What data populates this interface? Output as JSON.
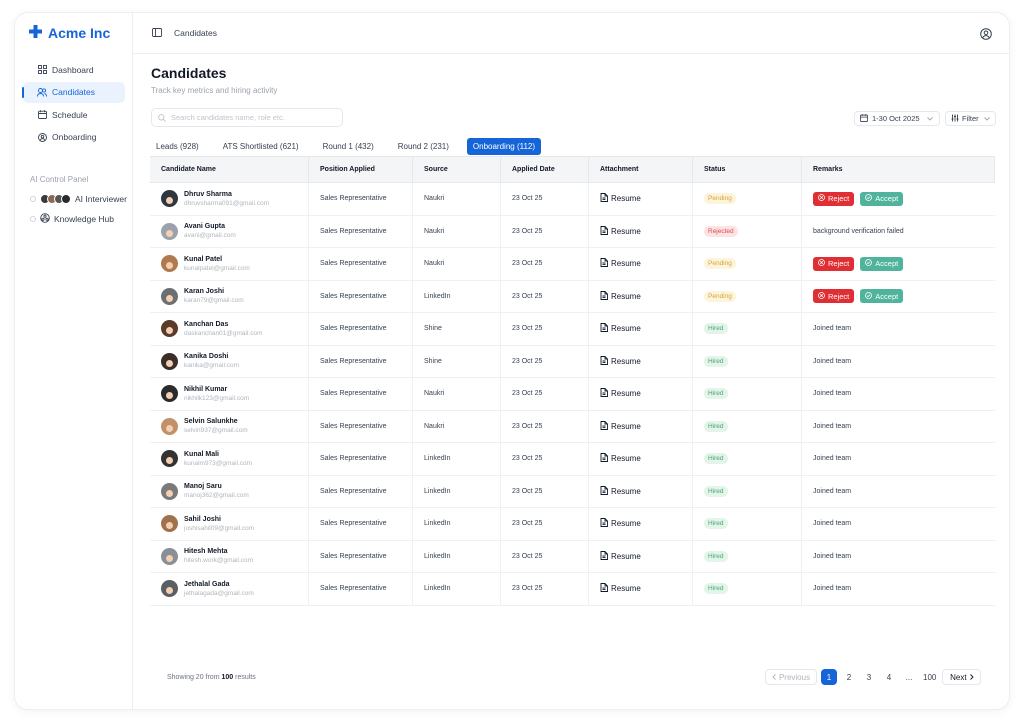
{
  "brand": {
    "name": "Acme Inc",
    "color": "#1565d8"
  },
  "sidebar": {
    "items": [
      {
        "label": "Dashboard",
        "icon": "grid-icon",
        "active": false
      },
      {
        "label": "Candidates",
        "icon": "users-icon",
        "active": true
      },
      {
        "label": "Schedule",
        "icon": "calendar-icon",
        "active": false
      },
      {
        "label": "Onboarding",
        "icon": "onboarding-icon",
        "active": false
      }
    ],
    "ai_panel": {
      "title": "AI Control Panel",
      "items": [
        {
          "label": "AI Interviewer",
          "icon": "avatars-group-icon"
        },
        {
          "label": "Knowledge Hub",
          "icon": "knowledge-hub-icon"
        }
      ]
    }
  },
  "topbar": {
    "breadcrumb": "Candidates",
    "sidebar_toggle_icon": "sidebar-toggle-icon",
    "user_icon": "user-circle-icon"
  },
  "page": {
    "title": "Candidates",
    "subtitle": "Track key metrics and hiring activity",
    "search_placeholder": "Search candidates name, role etc.",
    "date_range": "1-30 Oct 2025",
    "filter_label": "Filter"
  },
  "tabs": [
    {
      "label": "Leads (928)",
      "active": false
    },
    {
      "label": "ATS Shortlisted (621)",
      "active": false
    },
    {
      "label": "Round 1 (432)",
      "active": false
    },
    {
      "label": "Round 2 (231)",
      "active": false
    },
    {
      "label": "Onboarding (112)",
      "active": true
    }
  ],
  "table": {
    "columns": [
      "Candidate Name",
      "Position Applied",
      "Source",
      "Applied Date",
      "Attachment",
      "Status",
      "Remarks"
    ],
    "reject_label": "Reject",
    "accept_label": "Accept",
    "rows": [
      {
        "name": "Dhruv Sharma",
        "email": "dhruvsharma091@gmail.com",
        "position": "Sales Representative",
        "source": "Naukri",
        "date": "23 Oct 25",
        "attachment": "Resume",
        "status": "Pending",
        "remarks": "",
        "actions": true,
        "avatar_color": "#2f3640"
      },
      {
        "name": "Avani Gupta",
        "email": "avani@gmail.com",
        "position": "Sales Representative",
        "source": "Naukri",
        "date": "23 Oct 25",
        "attachment": "Resume",
        "status": "Rejected",
        "remarks": "background verification failed",
        "actions": false,
        "avatar_color": "#9aa3ad"
      },
      {
        "name": "Kunal Patel",
        "email": "kunalpatel@gmail.com",
        "position": "Sales Representative",
        "source": "Naukri",
        "date": "23 Oct 25",
        "attachment": "Resume",
        "status": "Pending",
        "remarks": "",
        "actions": true,
        "avatar_color": "#b07a4f"
      },
      {
        "name": "Karan Joshi",
        "email": "karan79@gmail.com",
        "position": "Sales Representative",
        "source": "LinkedIn",
        "date": "23 Oct 25",
        "attachment": "Resume",
        "status": "Pending",
        "remarks": "",
        "actions": true,
        "avatar_color": "#6d6f73"
      },
      {
        "name": "Kanchan Das",
        "email": "daskanchan01@gmail.com",
        "position": "Sales Representative",
        "source": "Shine",
        "date": "23 Oct 25",
        "attachment": "Resume",
        "status": "Hired",
        "remarks": "Joined team",
        "actions": false,
        "avatar_color": "#5a3a2a"
      },
      {
        "name": "Kanika Doshi",
        "email": "kanika@gmail.com",
        "position": "Sales Representative",
        "source": "Shine",
        "date": "23 Oct 25",
        "attachment": "Resume",
        "status": "Hired",
        "remarks": "Joined team",
        "actions": false,
        "avatar_color": "#3a2e2a"
      },
      {
        "name": "Nikhil Kumar",
        "email": "nikhilk123@gmail.com",
        "position": "Sales Representative",
        "source": "Naukri",
        "date": "23 Oct 25",
        "attachment": "Resume",
        "status": "Hired",
        "remarks": "Joined team",
        "actions": false,
        "avatar_color": "#2b2b2b"
      },
      {
        "name": "Selvin Salunkhe",
        "email": "selvin937@gmail.com",
        "position": "Sales Representative",
        "source": "Naukri",
        "date": "23 Oct 25",
        "attachment": "Resume",
        "status": "Hired",
        "remarks": "Joined team",
        "actions": false,
        "avatar_color": "#c2916a"
      },
      {
        "name": "Kunal Mali",
        "email": "kunalm973@gmail.com",
        "position": "Sales Representative",
        "source": "LinkedIn",
        "date": "23 Oct 25",
        "attachment": "Resume",
        "status": "Hired",
        "remarks": "Joined team",
        "actions": false,
        "avatar_color": "#333333"
      },
      {
        "name": "Manoj Saru",
        "email": "manoj362@gmail.com",
        "position": "Sales Representative",
        "source": "LinkedIn",
        "date": "23 Oct 25",
        "attachment": "Resume",
        "status": "Hired",
        "remarks": "Joined team",
        "actions": false,
        "avatar_color": "#7a7a7a"
      },
      {
        "name": "Sahil Joshi",
        "email": "joshisahil09@gmail.com",
        "position": "Sales Representative",
        "source": "LinkedIn",
        "date": "23 Oct 25",
        "attachment": "Resume",
        "status": "Hired",
        "remarks": "Joined team",
        "actions": false,
        "avatar_color": "#a0714d"
      },
      {
        "name": "Hitesh Mehta",
        "email": "hitesh.work@gmail.com",
        "position": "Sales Representative",
        "source": "LinkedIn",
        "date": "23 Oct 25",
        "attachment": "Resume",
        "status": "Hired",
        "remarks": "Joined team",
        "actions": false,
        "avatar_color": "#8a8f96"
      },
      {
        "name": "Jethalal Gada",
        "email": "jethalagada@gmail.com",
        "position": "Sales Representative",
        "source": "LinkedIn",
        "date": "23 Oct 25",
        "attachment": "Resume",
        "status": "Hired",
        "remarks": "Joined team",
        "actions": false,
        "avatar_color": "#5b5e63"
      }
    ]
  },
  "footer": {
    "showing_prefix": "Showing 20 from",
    "showing_total": "100",
    "showing_suffix": "results"
  },
  "pagination": {
    "prev_label": "Previous",
    "next_label": "Next",
    "pages": [
      "1",
      "2",
      "3",
      "4",
      "...",
      "100"
    ],
    "current": "1"
  }
}
